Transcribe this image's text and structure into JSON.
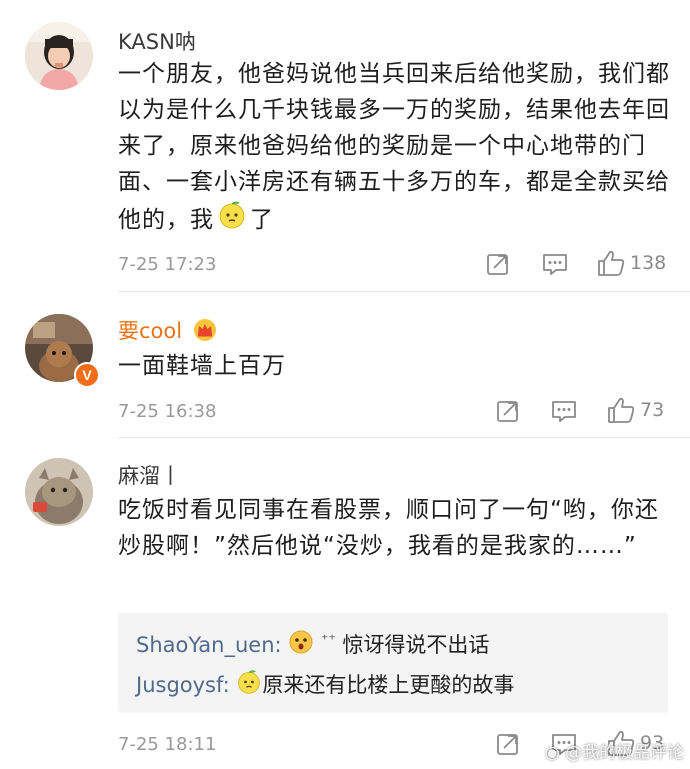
{
  "comments": [
    {
      "username": "KASN呐",
      "content_pre": "一个朋友，他爸妈说他当兵回来后给他奖励，我们都以为是什么几千块钱最多一万的奖励，结果他去年回来了，原来他爸妈给他的奖励是一个中心地带的门面、一套小洋房还有辆五十多万的车，都是全款买给他的，我",
      "content_post": "了",
      "emoji_icon": "sour-lemon-emoji",
      "time": "7-25 17:23",
      "likes": "138"
    },
    {
      "username": "要cool",
      "badge_icon": "crown-badge-icon",
      "verified_icon": "verified-v-icon",
      "content": "一面鞋墙上百万",
      "time": "7-25 16:38",
      "likes": "73"
    },
    {
      "username": "麻溜丨",
      "content": "吃饭时看见同事在看股票，顺口问了一句“哟，你还炒股啊！”然后他说“没炒，我看的是我家的……”",
      "time": "7-25 18:11",
      "likes": "93",
      "replies": [
        {
          "user": "ShaoYan_uen",
          "emoji": "shocked-emoji",
          "text": "惊讶得说不出话"
        },
        {
          "user": "Jusgoysf",
          "emoji": "sour-lemon-emoji",
          "text": "原来还有比楼上更酸的故事"
        }
      ]
    }
  ],
  "watermark": "@我的极品评论",
  "colors": {
    "orange_username": "#e8741a",
    "reply_user": "#506a8c",
    "meta_gray": "#9a9a9a"
  }
}
